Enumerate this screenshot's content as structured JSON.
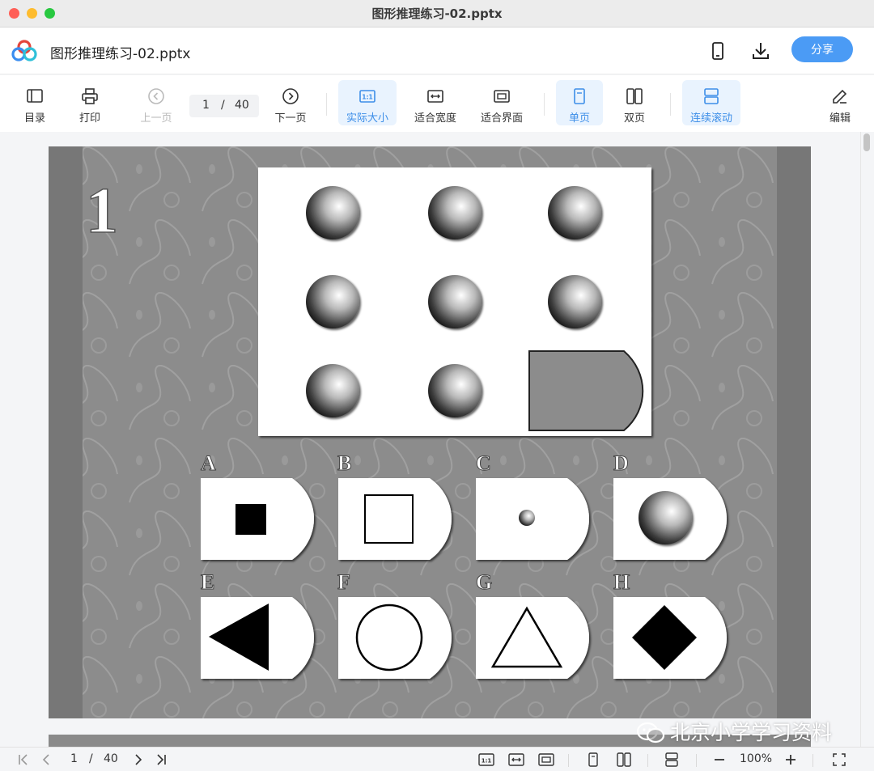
{
  "window": {
    "title": "图形推理练习-02.pptx"
  },
  "header": {
    "doc_title": "图形推理练习-02.pptx",
    "share_label": "分享",
    "icons": [
      "phone-icon",
      "download-icon"
    ]
  },
  "toolbar": {
    "toc": "目录",
    "print": "打印",
    "prev": "上一页",
    "page_current": "1",
    "page_sep": "/",
    "page_total": "40",
    "next": "下一页",
    "actual_size": "实际大小",
    "fit_width": "适合宽度",
    "fit_screen": "适合界面",
    "single_page": "单页",
    "double_page": "双页",
    "continuous": "连续滚动",
    "edit": "编辑"
  },
  "slide": {
    "number": "1",
    "options": [
      {
        "letter": "A",
        "shape": "filled-square"
      },
      {
        "letter": "B",
        "shape": "outline-square"
      },
      {
        "letter": "C",
        "shape": "small-sphere"
      },
      {
        "letter": "D",
        "shape": "sphere"
      },
      {
        "letter": "E",
        "shape": "filled-triangle"
      },
      {
        "letter": "F",
        "shape": "outline-circle"
      },
      {
        "letter": "G",
        "shape": "outline-triangle"
      },
      {
        "letter": "H",
        "shape": "filled-diamond"
      }
    ]
  },
  "statusbar": {
    "page_current": "1",
    "page_sep": "/",
    "page_total": "40",
    "zoom": "100%"
  },
  "watermark": {
    "text": "北京小学学习资料"
  },
  "colors": {
    "accent": "#4b9bf5",
    "active_bg": "#e9f3fe",
    "active_text": "#3d8ee8",
    "slide_bg": "#8a8a8a"
  }
}
